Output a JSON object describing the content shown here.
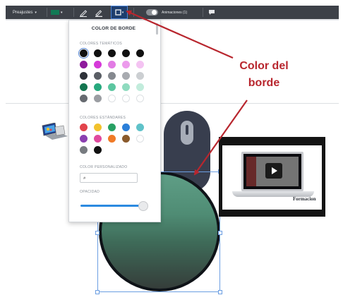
{
  "toolbar": {
    "presets_label": "Preajustes",
    "presets_caret": "▾",
    "fill_caret": "▾",
    "border_caret": "▾",
    "animations_label": "Animaciones (1)",
    "accent_color": "#4a83d8"
  },
  "color_popover": {
    "title": "COLOR DE BORDE",
    "theme_label": "COLORES TEMÁTICOS",
    "theme_colors": [
      "#111111",
      "#111111",
      "#111111",
      "#111111",
      "#111111",
      "#8e1a9c",
      "#d63ad9",
      "#e27be4",
      "#ec9bec",
      "#f4c3f2",
      "#2e3239",
      "#5a5e65",
      "#85898f",
      "#a8abb0",
      "#cccfd2",
      "#13754f",
      "#27a97e",
      "#5cc6a0",
      "#8fdbbf",
      "#c2ecdc",
      "#666a70",
      "#9b9ea3",
      "#ffffff",
      "#ffffff",
      "#ffffff"
    ],
    "standard_label": "COLORES ESTÁNDARES",
    "standard_colors": [
      "#e2434b",
      "#f2c22d",
      "#27a063",
      "#2b7fd9",
      "#5fc2c9",
      "#8b3fb0",
      "#e04a9e",
      "#f07a26",
      "#8a5a2c",
      "#ffffff",
      "#777b80",
      "#111111"
    ],
    "custom_label": "COLOR PERSONALIZADO",
    "custom_value": "#",
    "opacity_label": "OPACIDAD",
    "opacity_value": 1.0
  },
  "annotation": {
    "line1": "Color del",
    "line2": "borde",
    "color": "#b8262e"
  },
  "video_card": {
    "brand_text": "Formacion"
  }
}
